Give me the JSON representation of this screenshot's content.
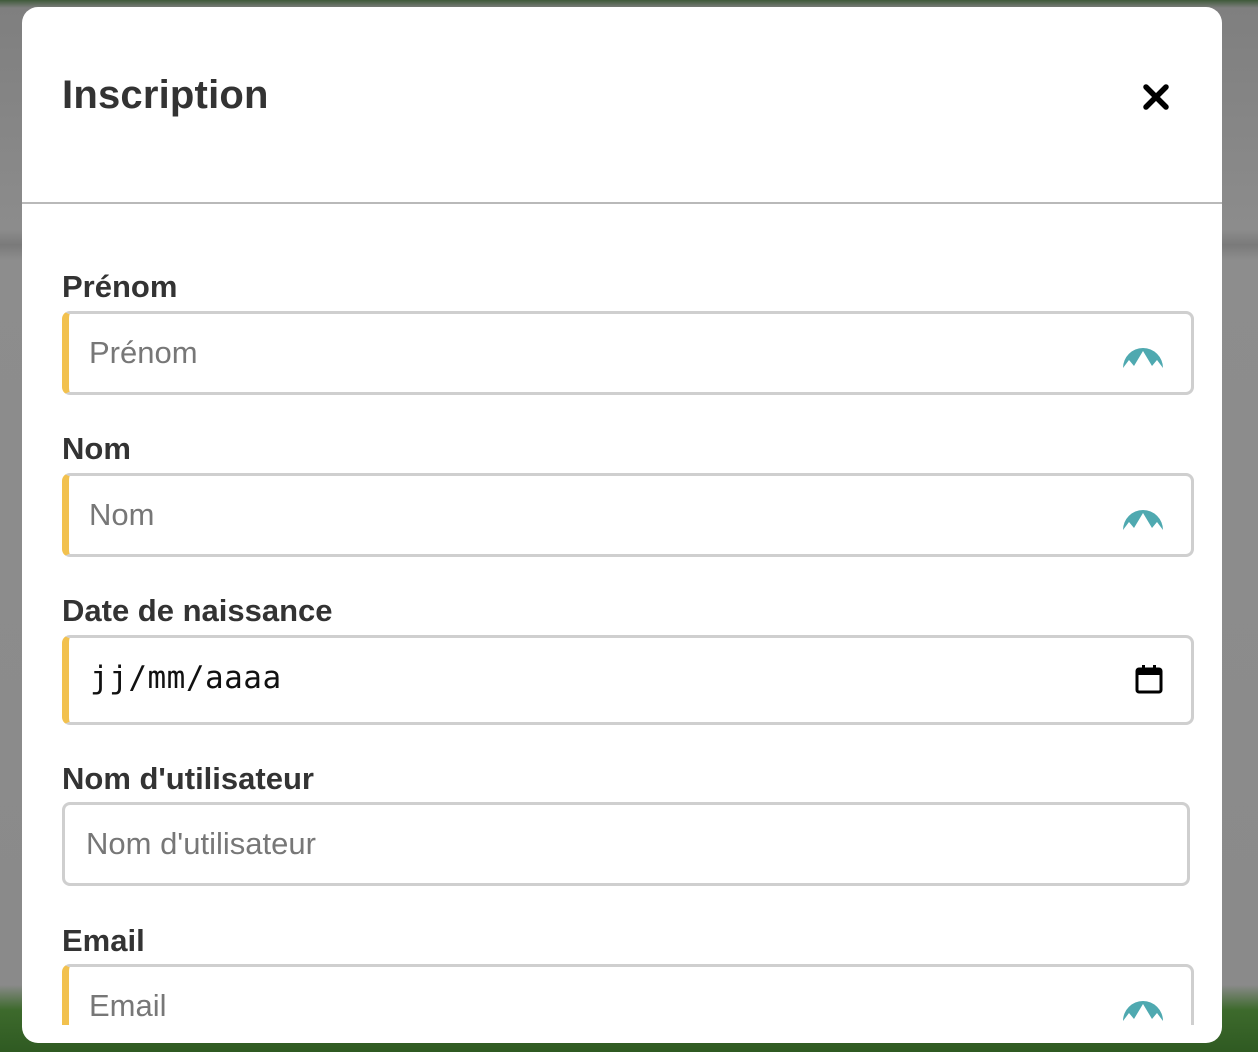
{
  "modal": {
    "title": "Inscription",
    "close_icon": "close-icon"
  },
  "form": {
    "first_name": {
      "label": "Prénom",
      "placeholder": "Prénom",
      "required": true,
      "icon": "autofill-icon"
    },
    "last_name": {
      "label": "Nom",
      "placeholder": "Nom",
      "required": true,
      "icon": "autofill-icon"
    },
    "birth_date": {
      "label": "Date de naissance",
      "value": "jj/mm/aaaa",
      "required": true,
      "icon": "calendar-icon"
    },
    "username": {
      "label": "Nom d'utilisateur",
      "placeholder": "Nom d'utilisateur",
      "required": false
    },
    "email": {
      "label": "Email",
      "placeholder": "Email",
      "required": true,
      "icon": "autofill-icon"
    }
  },
  "colors": {
    "required_accent": "#f2c14e",
    "autofill_icon": "#4fa9b0",
    "text": "#333333",
    "placeholder": "#777777",
    "border": "#cfcfcf"
  }
}
